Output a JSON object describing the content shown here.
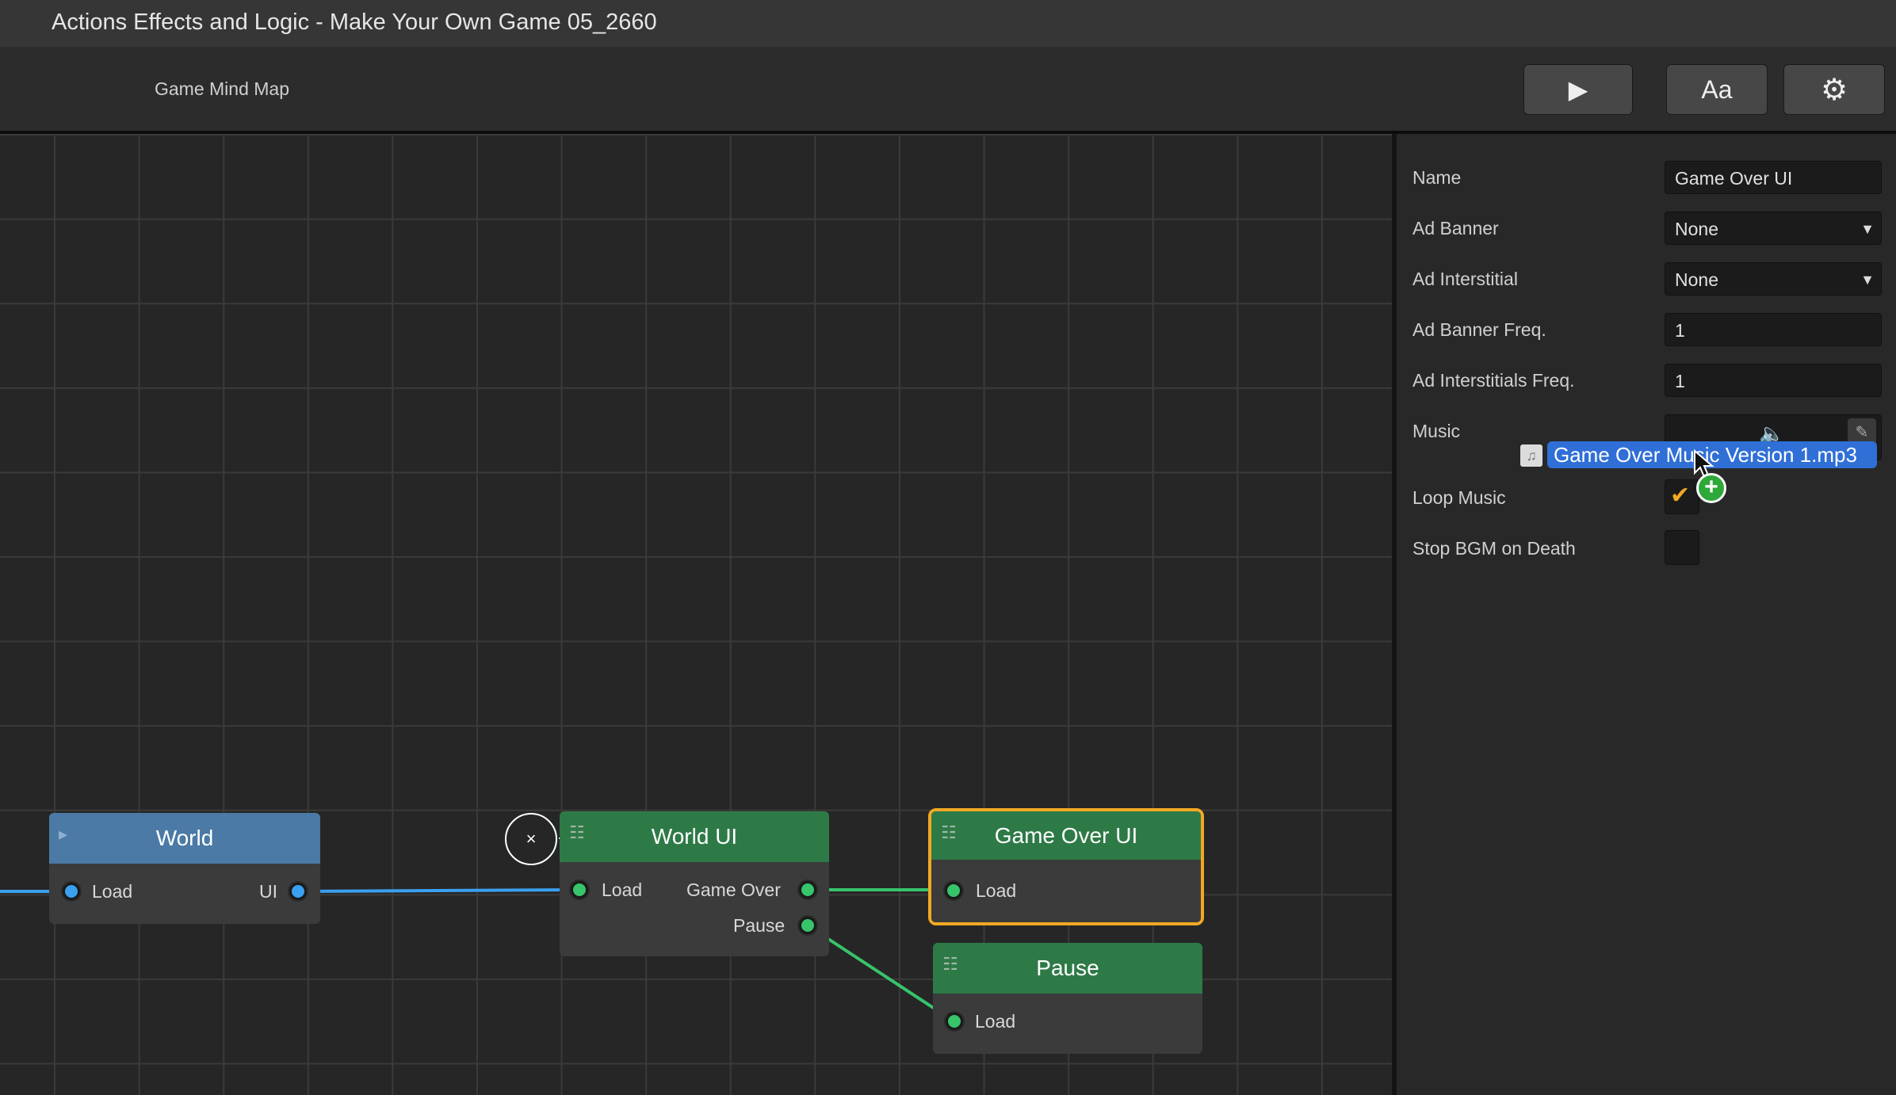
{
  "window": {
    "title": "Actions Effects and Logic - Make Your Own Game 05_2660"
  },
  "toolbar": {
    "label": "Game Mind Map",
    "play_label": "▶",
    "font_label": "Aa",
    "settings_label": "⚙"
  },
  "nodes": {
    "world": {
      "title": "World",
      "in_port": "Load",
      "out_port": "UI"
    },
    "world_ui": {
      "title": "World UI",
      "in_port": "Load",
      "out_port_1": "Game Over",
      "out_port_2": "Pause",
      "close_label": "×"
    },
    "game_over_ui": {
      "title": "Game Over UI",
      "in_port": "Load"
    },
    "pause": {
      "title": "Pause",
      "in_port": "Load"
    }
  },
  "properties": {
    "name_label": "Name",
    "name_value": "Game Over UI",
    "ad_banner_label": "Ad Banner",
    "ad_banner_value": "None",
    "ad_interstitial_label": "Ad Interstitial",
    "ad_interstitial_value": "None",
    "ad_banner_freq_label": "Ad Banner Freq.",
    "ad_banner_freq_value": "1",
    "ad_interstitials_freq_label": "Ad Interstitials Freq.",
    "ad_interstitials_freq_value": "1",
    "music_label": "Music",
    "loop_music_label": "Loop Music",
    "loop_music_checked": true,
    "stop_bgm_label": "Stop BGM on Death",
    "stop_bgm_checked": false
  },
  "drag": {
    "file_name": "Game Over Music Version 1.mp3",
    "add_badge": "+"
  },
  "colors": {
    "wire_green": "#37c46b",
    "wire_blue": "#3aa0f0",
    "selected_outline": "#f2a823"
  }
}
